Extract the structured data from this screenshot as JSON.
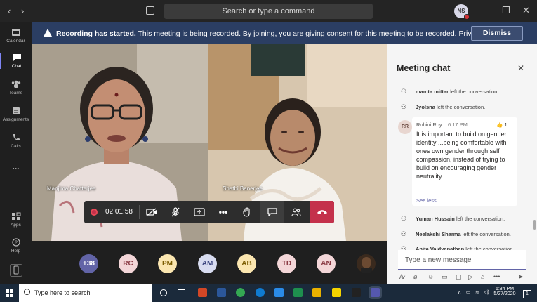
{
  "titlebar": {
    "search_placeholder": "Search or type a command",
    "user_initials": "NS"
  },
  "rail": {
    "items": [
      {
        "label": "Calendar",
        "icon": "calendar-icon"
      },
      {
        "label": "Chat",
        "icon": "chat-icon",
        "active": true
      },
      {
        "label": "Teams",
        "icon": "teams-icon"
      },
      {
        "label": "Assignments",
        "icon": "assignments-icon"
      },
      {
        "label": "Calls",
        "icon": "calls-icon"
      },
      {
        "label": "...",
        "icon": "more-icon"
      },
      {
        "label": "Apps",
        "icon": "apps-icon"
      },
      {
        "label": "Help",
        "icon": "help-icon"
      }
    ]
  },
  "banner": {
    "bold": "Recording has started.",
    "text": " This meeting is being recorded. By joining, you are giving consent for this meeting to be recorded. ",
    "link": "Privacy policy",
    "dismiss_label": "Dismiss"
  },
  "stage": {
    "participants": [
      {
        "name": "Manjima Chatterjee"
      },
      {
        "name": "Shatbi Banerjee"
      }
    ]
  },
  "controls": {
    "timer": "02:01:58"
  },
  "strip": {
    "avatars": [
      {
        "label": "+38",
        "bg": "#6264a7",
        "fg": "#ffffff"
      },
      {
        "label": "RC",
        "bg": "#f3d6d8",
        "fg": "#8a3a44"
      },
      {
        "label": "PM",
        "bg": "#fbe6b0",
        "fg": "#7a5b00"
      },
      {
        "label": "AM",
        "bg": "#d8dcf0",
        "fg": "#3d4780"
      },
      {
        "label": "AB",
        "bg": "#fbe6b0",
        "fg": "#7a5b00"
      },
      {
        "label": "TD",
        "bg": "#f3d6d8",
        "fg": "#8a3a44"
      },
      {
        "label": "AN",
        "bg": "#f3d6d8",
        "fg": "#8a3a44"
      },
      {
        "label": "",
        "bg": "#3a2a1e",
        "fg": "#ffffff"
      }
    ]
  },
  "chat": {
    "title": "Meeting chat",
    "events": [
      {
        "name": "mamta mittar",
        "action": "left the conversation."
      },
      {
        "name": "Jyolsna",
        "action": "left the conversation."
      }
    ],
    "message": {
      "initials": "RR",
      "author": "Rohini Roy",
      "time": "6:17 PM",
      "likes": "1",
      "body": "It is important to build on gender identity ...being comfortable with ones own gender through self compassion, instead of trying to build on encouraging gender neutrality.",
      "see_less": "See less"
    },
    "events_after": [
      {
        "name": "Yuman Hussain",
        "action": "left the conversation."
      },
      {
        "name": "Neelakshi Sharma",
        "action": "left the conversation."
      },
      {
        "name": "Anita Vaidyanathan",
        "action": "left the conversation."
      }
    ],
    "compose_placeholder": "Type a new message"
  },
  "taskbar": {
    "search_placeholder": "Type here to search",
    "time": "6:34 PM",
    "date": "5/27/2020",
    "notifications": "1"
  }
}
